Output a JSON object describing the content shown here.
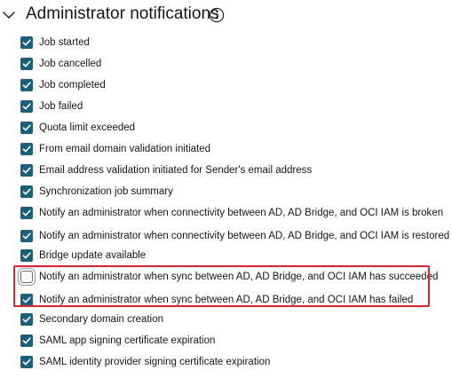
{
  "section": {
    "title": "Administrator notifications",
    "collapse_icon": "chevron-down-icon",
    "info_icon": "info-icon"
  },
  "colors": {
    "checkbox_checked": "#1c5f7a",
    "highlight_border": "#d9262c",
    "text": "#161513"
  },
  "options": [
    {
      "label": "Job started",
      "checked": true
    },
    {
      "label": "Job cancelled",
      "checked": true
    },
    {
      "label": "Job completed",
      "checked": true
    },
    {
      "label": "Job failed",
      "checked": true
    },
    {
      "label": "Quota limit exceeded",
      "checked": true
    },
    {
      "label": "From email domain validation initiated",
      "checked": true
    },
    {
      "label": "Email address validation initiated for Sender's email address",
      "checked": true
    },
    {
      "label": "Synchronization job summary",
      "checked": true
    },
    {
      "label": "Notify an administrator when connectivity between AD, AD Bridge, and OCI IAM is broken",
      "checked": true
    },
    {
      "label": "Notify an administrator when connectivity between AD, AD Bridge, and OCI IAM is restored",
      "checked": true
    },
    {
      "label": "Bridge update available",
      "checked": true
    },
    {
      "label": "Notify an administrator when sync between AD, AD Bridge, and OCI IAM has succeeded",
      "checked": false
    },
    {
      "label": "Notify an administrator when sync between AD, AD Bridge, and OCI IAM has failed",
      "checked": true
    },
    {
      "label": "Secondary domain creation",
      "checked": true
    },
    {
      "label": "SAML app signing certificate expiration",
      "checked": true
    },
    {
      "label": "SAML identity provider signing certificate expiration",
      "checked": true
    }
  ]
}
